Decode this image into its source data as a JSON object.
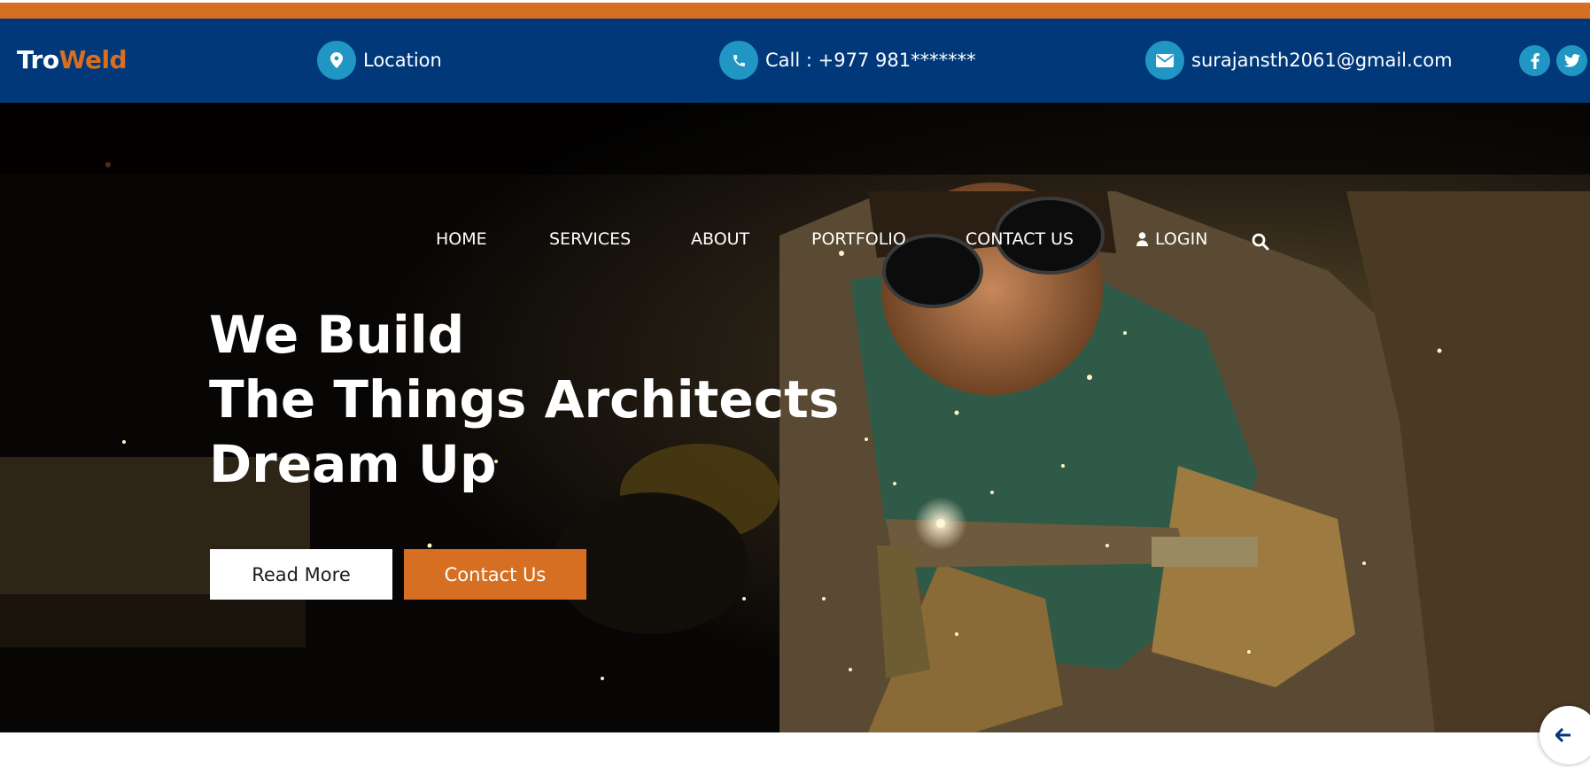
{
  "brand": {
    "part1": "Tro",
    "part2": "Weld"
  },
  "topbar": {
    "location": "Location",
    "phone": "Call : +977 981*******",
    "email": "surajansth2061@gmail.com"
  },
  "nav": {
    "items": [
      "HOME",
      "SERVICES",
      "ABOUT",
      "PORTFOLIO",
      "CONTACT US"
    ],
    "login": "LOGIN"
  },
  "hero": {
    "line1": "We Build",
    "line2": "The Things Architects",
    "line3": "Dream Up",
    "read_more": "Read More",
    "contact_us": "Contact Us"
  },
  "icons": {
    "location": "map-marker-icon",
    "phone": "phone-icon",
    "email": "envelope-icon",
    "facebook": "facebook-icon",
    "twitter": "twitter-icon",
    "login": "user-icon",
    "search": "search-icon",
    "back": "arrow-left-icon"
  },
  "colors": {
    "brand_orange": "#d66f22",
    "header_blue": "#003879",
    "icon_blue": "#2196c4"
  }
}
